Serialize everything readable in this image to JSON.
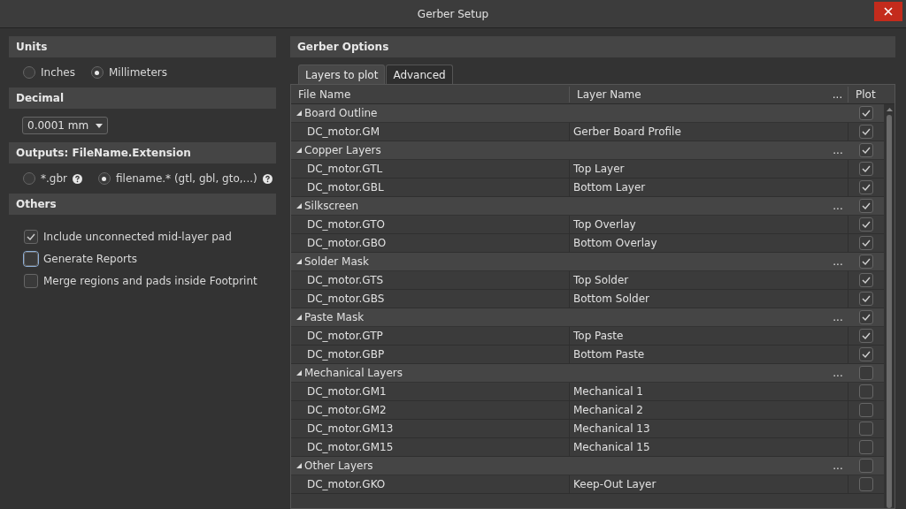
{
  "window": {
    "title": "Gerber Setup"
  },
  "sections": [
    {
      "kind": "radios",
      "title": "Units",
      "options": [
        {
          "label": "Inches",
          "selected": false,
          "help": false
        },
        {
          "label": "Millimeters",
          "selected": true,
          "help": false
        }
      ]
    },
    {
      "kind": "dropdown",
      "title": "Decimal",
      "value": "0.0001 mm"
    },
    {
      "kind": "radios",
      "title": "Outputs: FileName.Extension",
      "options": [
        {
          "label": "*.gbr",
          "selected": false,
          "help": true
        },
        {
          "label": "filename.* (gtl, gbl, gto,...)",
          "selected": true,
          "help": true
        }
      ]
    },
    {
      "kind": "checks",
      "title": "Others",
      "options": [
        {
          "label": "Include unconnected mid-layer pad",
          "checked": true,
          "focused": false
        },
        {
          "label": "Generate Reports",
          "checked": false,
          "focused": true
        },
        {
          "label": "Merge regions and pads inside Footprint",
          "checked": false,
          "focused": false
        }
      ]
    }
  ],
  "gerber_options": {
    "title": "Gerber Options",
    "tabs": [
      {
        "label": "Layers to plot",
        "selected": true
      },
      {
        "label": "Advanced",
        "selected": false
      }
    ],
    "columns": [
      "File Name",
      "Layer Name",
      "...",
      "Plot"
    ],
    "rows": [
      {
        "kind": "group",
        "name": "Board Outline",
        "plot": true
      },
      {
        "kind": "item",
        "file": "DC_motor.GM",
        "layer": "Gerber Board Profile",
        "plot": true
      },
      {
        "kind": "group",
        "name": "Copper Layers",
        "more": "...",
        "plot": true
      },
      {
        "kind": "item",
        "file": "DC_motor.GTL",
        "layer": "Top Layer",
        "plot": true
      },
      {
        "kind": "item",
        "file": "DC_motor.GBL",
        "layer": "Bottom Layer",
        "plot": true
      },
      {
        "kind": "group",
        "name": "Silkscreen",
        "more": "...",
        "plot": true
      },
      {
        "kind": "item",
        "file": "DC_motor.GTO",
        "layer": "Top Overlay",
        "plot": true
      },
      {
        "kind": "item",
        "file": "DC_motor.GBO",
        "layer": "Bottom Overlay",
        "plot": true
      },
      {
        "kind": "group",
        "name": "Solder Mask",
        "more": "...",
        "plot": true
      },
      {
        "kind": "item",
        "file": "DC_motor.GTS",
        "layer": "Top Solder",
        "plot": true
      },
      {
        "kind": "item",
        "file": "DC_motor.GBS",
        "layer": "Bottom Solder",
        "plot": true
      },
      {
        "kind": "group",
        "name": "Paste Mask",
        "more": "...",
        "plot": true
      },
      {
        "kind": "item",
        "file": "DC_motor.GTP",
        "layer": "Top Paste",
        "plot": true
      },
      {
        "kind": "item",
        "file": "DC_motor.GBP",
        "layer": "Bottom Paste",
        "plot": true
      },
      {
        "kind": "group",
        "name": "Mechanical Layers",
        "more": "...",
        "plot": false
      },
      {
        "kind": "item",
        "file": "DC_motor.GM1",
        "layer": "Mechanical 1",
        "plot": false
      },
      {
        "kind": "item",
        "file": "DC_motor.GM2",
        "layer": "Mechanical 2",
        "plot": false
      },
      {
        "kind": "item",
        "file": "DC_motor.GM13",
        "layer": "Mechanical 13",
        "plot": false
      },
      {
        "kind": "item",
        "file": "DC_motor.GM15",
        "layer": "Mechanical 15",
        "plot": false
      },
      {
        "kind": "group",
        "name": "Other Layers",
        "more": "...",
        "plot": false
      },
      {
        "kind": "item",
        "file": "DC_motor.GKO",
        "layer": "Keep-Out Layer",
        "plot": false
      }
    ]
  }
}
